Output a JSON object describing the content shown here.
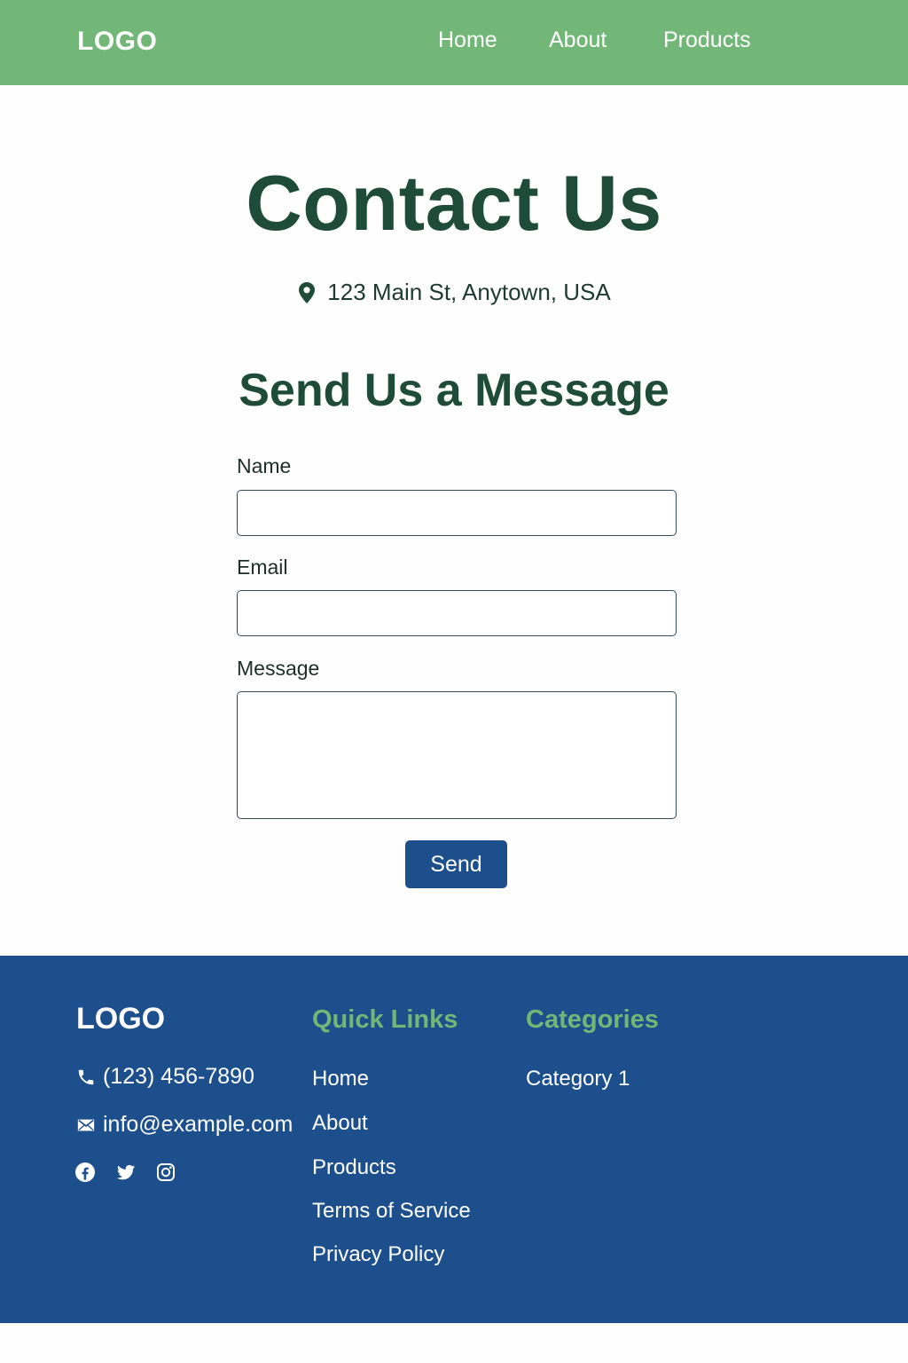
{
  "header": {
    "logo": "LOGO",
    "nav": [
      "Home",
      "About",
      "Products"
    ],
    "background_color": "#72b777"
  },
  "main": {
    "title": "Contact Us",
    "address": "123 Main St, Anytown, USA",
    "address_icon": "location-pin-icon",
    "form": {
      "title": "Send Us a Message",
      "name_label": "Name",
      "name_value": "",
      "email_label": "Email",
      "email_value": "",
      "message_label": "Message",
      "message_value": "",
      "submit_label": "Send"
    },
    "title_color": "#1f4c3a",
    "button_color": "#1c4f8b"
  },
  "footer": {
    "logo": "LOGO",
    "phone": "(123) 456-7890",
    "phone_icon": "phone-icon",
    "email": "info@example.com",
    "email_icon": "envelope-icon",
    "social": [
      "facebook-icon",
      "twitter-icon",
      "instagram-icon"
    ],
    "quick_links": {
      "title": "Quick Links",
      "items": [
        "Home",
        "About",
        "Products",
        "Terms of Service",
        "Privacy Policy"
      ]
    },
    "categories": {
      "title": "Categories",
      "items": [
        "Category 1"
      ]
    },
    "background_color": "#1c4f8b",
    "heading_color": "#72b777"
  }
}
